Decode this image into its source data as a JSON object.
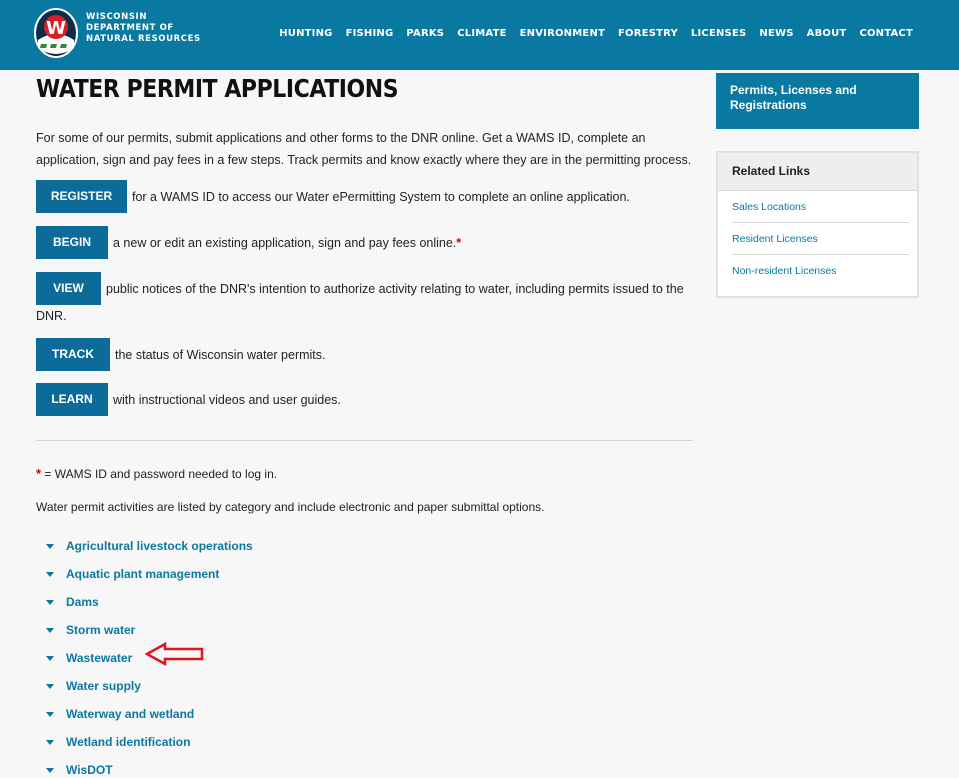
{
  "header": {
    "agency_lines": [
      "WISCONSIN",
      "DEPARTMENT OF",
      "NATURAL RESOURCES"
    ],
    "logo_letter": "W",
    "nav": [
      "HUNTING",
      "FISHING",
      "PARKS",
      "CLIMATE",
      "ENVIRONMENT",
      "FORESTRY",
      "LICENSES",
      "NEWS",
      "ABOUT",
      "CONTACT"
    ]
  },
  "page": {
    "title": "WATER PERMIT APPLICATIONS",
    "intro": "For some of our permits, submit applications and other forms to the DNR online. Get a WAMS ID, complete an application, sign and pay fees in a few steps. Track permits and know exactly where they are in the permitting process."
  },
  "actions": [
    {
      "label": "REGISTER",
      "text": "for a WAMS ID to access our Water ePermitting System to complete an online application."
    },
    {
      "label": "BEGIN",
      "text": "a new or edit an existing application, sign and pay fees online.",
      "marker": "*"
    },
    {
      "label": "VIEW",
      "text": "public notices of the DNR's intention to authorize activity relating to water, including permits issued to the",
      "text_continued": "DNR."
    },
    {
      "label": "TRACK",
      "text": "the status of Wisconsin water permits."
    },
    {
      "label": "LEARN",
      "text": "with instructional videos and user guides."
    }
  ],
  "notes": {
    "marker": "*",
    "footnote": " = WAMS ID and password needed to log in.",
    "categories_intro": "Water permit activities are listed by category and include electronic and paper submittal options."
  },
  "categories": [
    "Agricultural livestock operations",
    "Aquatic plant management",
    "Dams",
    "Storm water",
    "Wastewater",
    "Water supply",
    "Waterway and wetland",
    "Wetland identification",
    "WisDOT"
  ],
  "sidebar": {
    "section_title": "Permits, Licenses and Registrations",
    "related_title": "Related Links",
    "related_links": [
      "Sales Locations",
      "Resident Licenses",
      "Non-resident Licenses"
    ]
  },
  "colors": {
    "brand_blue": "#0a79a1",
    "button_blue": "#0d6b99",
    "required_red": "#d40000",
    "annotation_arrow": "#e0141e"
  },
  "icons": {
    "category_toggle": "caret-down-icon",
    "annotation": "red-arrow-icon"
  }
}
